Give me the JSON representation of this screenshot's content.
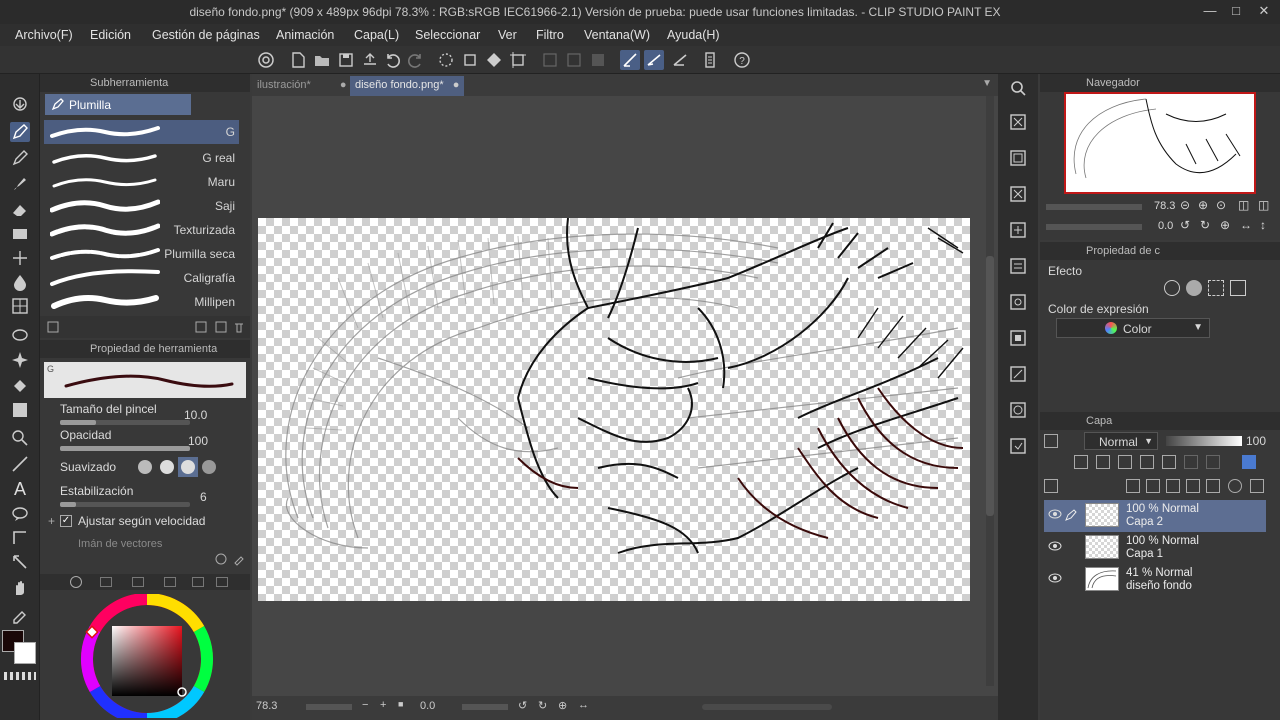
{
  "window": {
    "title": "diseño fondo.png* (909 x 489px 96dpi 78.3% : RGB:sRGB IEC61966-2.1)  Versión de prueba: puede usar funciones limitadas. - CLIP STUDIO PAINT EX"
  },
  "menu": [
    "Archivo(F)",
    "Edición",
    "Gestión de páginas",
    "Animación",
    "Capa(L)",
    "Seleccionar",
    "Ver",
    "Filtro",
    "Ventana(W)",
    "Ayuda(H)"
  ],
  "subtool": {
    "header": "Subherramienta",
    "group": "Plumilla",
    "brushes": [
      "G",
      "G real",
      "Maru",
      "Saji",
      "Texturizada",
      "Plumilla seca",
      "Caligrafía",
      "Millipen"
    ],
    "selected_brush": "G"
  },
  "toolprop": {
    "header": "Propiedad de herramienta",
    "preview_tag": "G",
    "brush_size_label": "Tamaño del pincel",
    "brush_size_value": "10.0",
    "opacity_label": "Opacidad",
    "opacity_value": "100",
    "smoothing_label": "Suavizado",
    "stabilization_label": "Estabilización",
    "stabilization_value": "6",
    "adjust_speed_label": "Ajustar según velocidad",
    "adjust_speed_checked": true,
    "vector_magnet_label": "Imán de vectores"
  },
  "canvas": {
    "tabs": [
      "ilustración*",
      "diseño fondo.png*"
    ],
    "active_tab": "diseño fondo.png*",
    "zoom": "78.3",
    "rotation": "0.0"
  },
  "navigator": {
    "header": "Navegador",
    "zoom": "78.3",
    "angle": "0.0"
  },
  "layer_property": {
    "header": "Propiedad de c",
    "effect_label": "Efecto",
    "expression_color_label": "Color de expresión",
    "expression_color_value": "Color"
  },
  "layers": {
    "header": "Capa",
    "blend_mode": "Normal",
    "opacity": "100",
    "items": [
      {
        "opacity": "100 %",
        "mode": "Normal",
        "name": "Capa 2",
        "selected": true
      },
      {
        "opacity": "100 %",
        "mode": "Normal",
        "name": "Capa 1",
        "selected": false
      },
      {
        "opacity": "41 %",
        "mode": "Normal",
        "name": "diseño fondo",
        "selected": false
      }
    ]
  },
  "colors": {
    "accent": "#5b6e92",
    "main_color": "#1a0808",
    "sub_color": "#ffffff"
  }
}
